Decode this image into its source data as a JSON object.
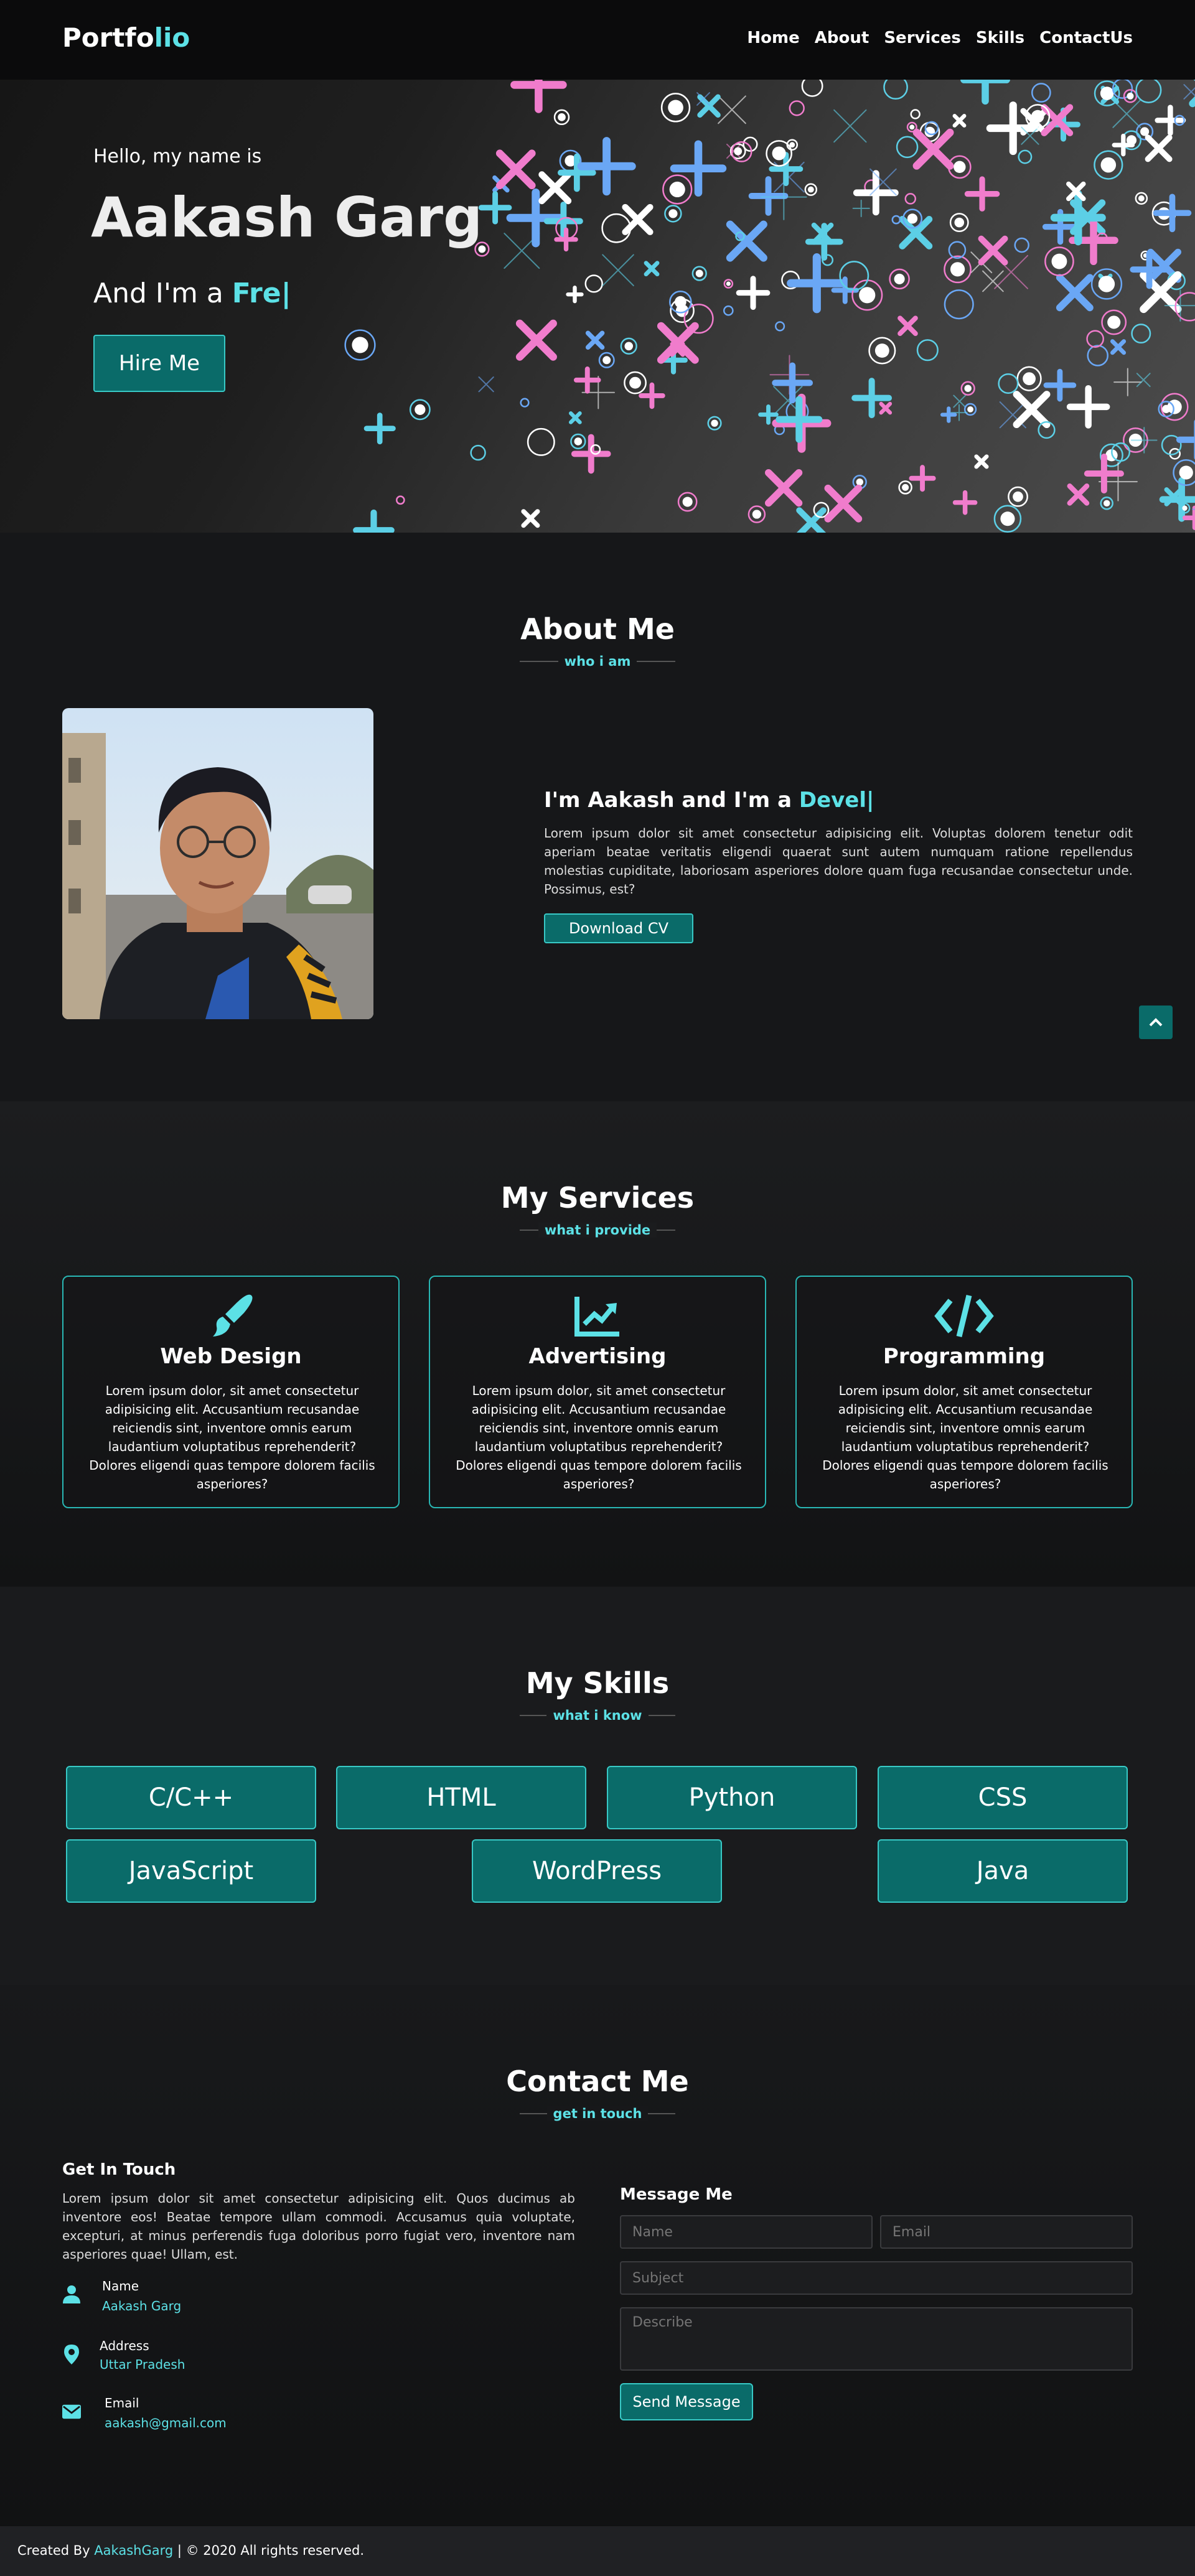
{
  "colors": {
    "accent": "#5ce1e6",
    "button": "#0a6b69",
    "button_border": "#38c9c6",
    "background": "#161719"
  },
  "nav": {
    "logo_main": "Portfo",
    "logo_accent": "lio",
    "items": [
      "Home",
      "About",
      "Services",
      "Skills",
      "ContactUs"
    ]
  },
  "hero": {
    "greeting": "Hello, my name is",
    "name": "Aakash Garg",
    "typing_prefix": "And I'm a ",
    "typing_word": "Fre",
    "cursor": "|",
    "hire_label": "Hire Me"
  },
  "about": {
    "title": "About Me",
    "subtitle": "who i am",
    "heading_prefix": "I'm Aakash and I'm a ",
    "heading_word": "Devel",
    "cursor": "|",
    "text": "Lorem ipsum dolor sit amet consectetur adipisicing elit. Voluptas dolorem tenetur odit aperiam beatae veritatis eligendi quaerat sunt autem numquam ratione repellendus molestias cupiditate, laboriosam asperiores dolore quam fuga recusandae consectetur unde. Possimus, est?",
    "cv_label": "Download CV",
    "scroll_top_icon": "chevron-up-icon"
  },
  "services": {
    "title": "My Services",
    "subtitle": "what i provide",
    "cards": [
      {
        "icon": "paint-brush-icon",
        "title": "Web Design",
        "text": "Lorem ipsum dolor, sit amet consectetur adipisicing elit. Accusantium recusandae reiciendis sint, inventore omnis earum laudantium voluptatibus reprehenderit? Dolores eligendi quas tempore dolorem facilis asperiores?"
      },
      {
        "icon": "chart-line-icon",
        "title": "Advertising",
        "text": "Lorem ipsum dolor, sit amet consectetur adipisicing elit. Accusantium recusandae reiciendis sint, inventore omnis earum laudantium voluptatibus reprehenderit? Dolores eligendi quas tempore dolorem facilis asperiores?"
      },
      {
        "icon": "code-icon",
        "title": "Programming",
        "text": "Lorem ipsum dolor, sit amet consectetur adipisicing elit. Accusantium recusandae reiciendis sint, inventore omnis earum laudantium voluptatibus reprehenderit? Dolores eligendi quas tempore dolorem facilis asperiores?"
      }
    ]
  },
  "skills": {
    "title": "My Skills",
    "subtitle": "what i know",
    "items": [
      "C/C++",
      "HTML",
      "Python",
      "CSS",
      "JavaScript",
      "WordPress",
      "Java"
    ]
  },
  "contact": {
    "title": "Contact Me",
    "subtitle": "get in touch",
    "git_title": "Get In Touch",
    "git_text": "Lorem ipsum dolor sit amet consectetur adipisicing elit. Quos ducimus ab inventore eos! Beatae tempore ullam commodi. Accusamus quia voluptate, excepturi, at minus perferendis fuga doloribus porro fugiat vero, inventore nam asperiores quae! Ullam, est.",
    "info": [
      {
        "icon": "user-icon",
        "label": "Name",
        "value": "Aakash Garg"
      },
      {
        "icon": "map-pin-icon",
        "label": "Address",
        "value": "Uttar Pradesh"
      },
      {
        "icon": "envelope-icon",
        "label": "Email",
        "value": "aakash@gmail.com"
      }
    ],
    "form_title": "Message Me",
    "name_placeholder": "Name",
    "email_placeholder": "Email",
    "subject_placeholder": "Subject",
    "describe_placeholder": "Describe",
    "send_label": "Send Message"
  },
  "footer": {
    "prefix": "Created By ",
    "author": "AakashGarg",
    "suffix": " | © 2020 All rights reserved."
  }
}
